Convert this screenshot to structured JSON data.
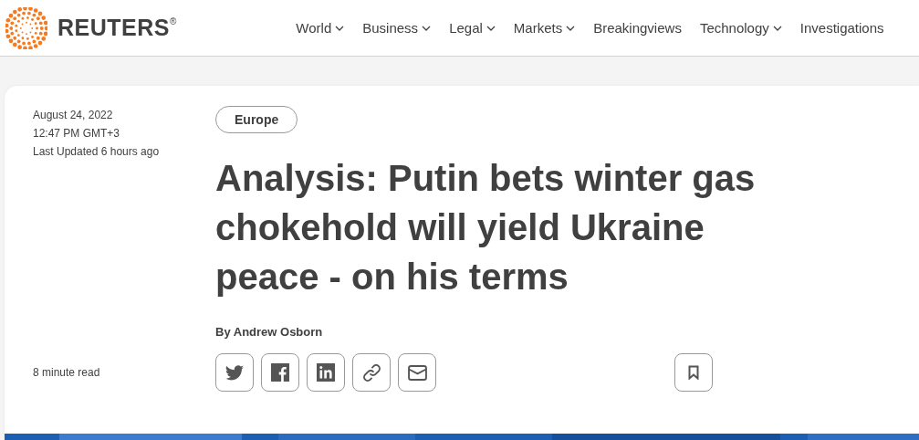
{
  "header": {
    "brand": "REUTERS",
    "registered": "®",
    "nav": [
      {
        "label": "World",
        "dropdown": true
      },
      {
        "label": "Business",
        "dropdown": true
      },
      {
        "label": "Legal",
        "dropdown": true
      },
      {
        "label": "Markets",
        "dropdown": true
      },
      {
        "label": "Breakingviews",
        "dropdown": false
      },
      {
        "label": "Technology",
        "dropdown": true
      },
      {
        "label": "Investigations",
        "dropdown": false
      }
    ]
  },
  "article": {
    "date": "August 24, 2022",
    "time": "12:47 PM GMT+3",
    "updated": "Last Updated 6 hours ago",
    "read_time": "8 minute read",
    "section": "Europe",
    "headline": "Analysis: Putin bets winter gas chokehold will yield Ukraine peace - on his terms",
    "byline": "By Andrew Osborn",
    "share": [
      {
        "kind": "twitter"
      },
      {
        "kind": "facebook"
      },
      {
        "kind": "linkedin"
      },
      {
        "kind": "link"
      },
      {
        "kind": "email"
      }
    ]
  }
}
